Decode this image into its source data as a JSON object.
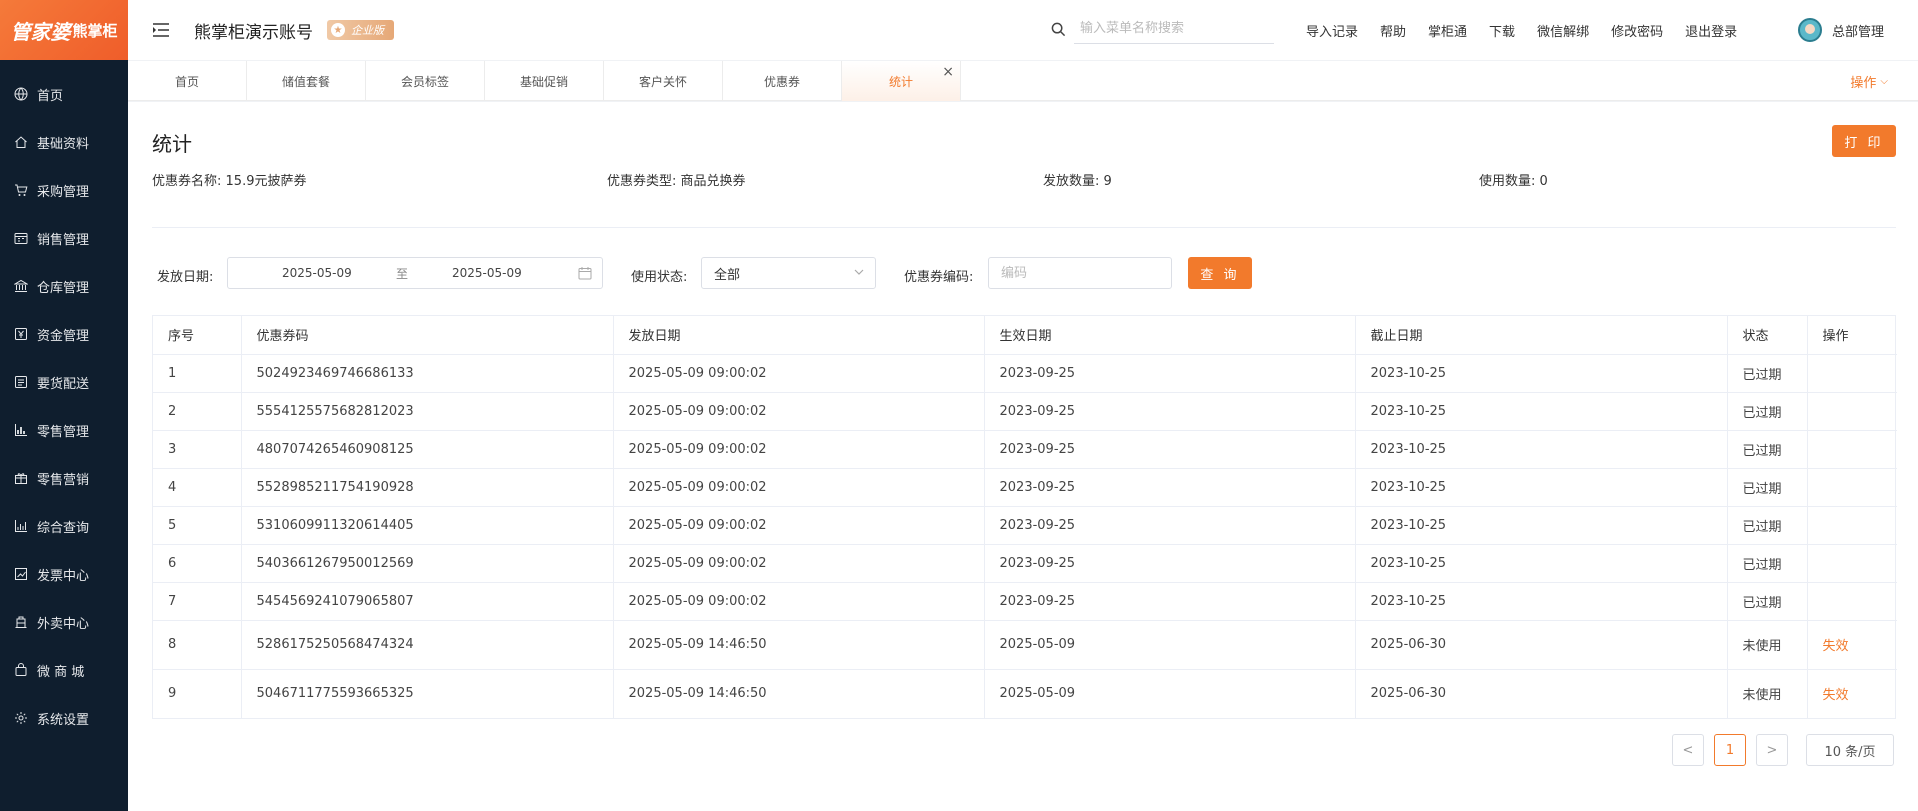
{
  "logo": {
    "text_a": "管家婆",
    "text_b": "熊掌柜"
  },
  "sidebar": {
    "items": [
      {
        "label": "首页",
        "icon": "globe-icon"
      },
      {
        "label": "基础资料",
        "icon": "home-icon"
      },
      {
        "label": "采购管理",
        "icon": "cart-icon"
      },
      {
        "label": "销售管理",
        "icon": "calendar-icon"
      },
      {
        "label": "仓库管理",
        "icon": "bank-icon"
      },
      {
        "label": "资金管理",
        "icon": "yen-icon"
      },
      {
        "label": "要货配送",
        "icon": "list-icon"
      },
      {
        "label": "零售管理",
        "icon": "bar-chart-icon"
      },
      {
        "label": "零售营销",
        "icon": "gift-icon"
      },
      {
        "label": "综合查询",
        "icon": "stats-icon"
      },
      {
        "label": "发票中心",
        "icon": "line-chart-icon"
      },
      {
        "label": "外卖中心",
        "icon": "delivery-icon"
      },
      {
        "label": "微 商 城",
        "icon": "bag-icon"
      },
      {
        "label": "系统设置",
        "icon": "gear-icon"
      }
    ]
  },
  "header": {
    "account_title": "熊掌柜演示账号",
    "badge": "企业版",
    "search_placeholder": "输入菜单名称搜索",
    "links": [
      "导入记录",
      "帮助",
      "掌柜通",
      "下载",
      "微信解绑",
      "修改密码",
      "退出登录"
    ],
    "user_name": "总部管理"
  },
  "tabs": {
    "items": [
      "首页",
      "储值套餐",
      "会员标签",
      "基础促销",
      "客户关怀",
      "优惠券",
      "统计"
    ],
    "active_index": 6,
    "ops_label": "操作"
  },
  "page": {
    "title": "统计",
    "print_label": "打 印",
    "info": [
      {
        "key": "优惠券名称:",
        "value": "15.9元披萨券"
      },
      {
        "key": "优惠券类型:",
        "value": "商品兑换券"
      },
      {
        "key": "发放数量:",
        "value": "9"
      },
      {
        "key": "使用数量:",
        "value": "0"
      }
    ]
  },
  "filters": {
    "date_label": "发放日期:",
    "date_start": "2025-05-09",
    "date_sep": "至",
    "date_end": "2025-05-09",
    "status_label": "使用状态:",
    "status_value": "全部",
    "code_label": "优惠券编码:",
    "code_placeholder": "编码",
    "query_label": "查 询"
  },
  "table": {
    "columns": [
      "序号",
      "优惠券码",
      "发放日期",
      "生效日期",
      "截止日期",
      "状态",
      "操作"
    ],
    "rows": [
      [
        "1",
        "5024923469746686133",
        "2025-05-09 09:00:02",
        "2023-09-25",
        "2023-10-25",
        "已过期",
        ""
      ],
      [
        "2",
        "5554125575682812023",
        "2025-05-09 09:00:02",
        "2023-09-25",
        "2023-10-25",
        "已过期",
        ""
      ],
      [
        "3",
        "4807074265460908125",
        "2025-05-09 09:00:02",
        "2023-09-25",
        "2023-10-25",
        "已过期",
        ""
      ],
      [
        "4",
        "5528985211754190928",
        "2025-05-09 09:00:02",
        "2023-09-25",
        "2023-10-25",
        "已过期",
        ""
      ],
      [
        "5",
        "5310609911320614405",
        "2025-05-09 09:00:02",
        "2023-09-25",
        "2023-10-25",
        "已过期",
        ""
      ],
      [
        "6",
        "5403661267950012569",
        "2025-05-09 09:00:02",
        "2023-09-25",
        "2023-10-25",
        "已过期",
        ""
      ],
      [
        "7",
        "5454569241079065807",
        "2025-05-09 09:00:02",
        "2023-09-25",
        "2023-10-25",
        "已过期",
        ""
      ],
      [
        "8",
        "5286175250568474324",
        "2025-05-09 14:46:50",
        "2025-05-09",
        "2025-06-30",
        "未使用",
        "失效"
      ],
      [
        "9",
        "5046711775593665325",
        "2025-05-09 14:46:50",
        "2025-05-09",
        "2025-06-30",
        "未使用",
        "失效"
      ]
    ]
  },
  "pagination": {
    "prev": "<",
    "current": "1",
    "next": ">",
    "page_size": "10 条/页"
  },
  "colors": {
    "accent": "#f27a2c",
    "sidebar_bg": "#0f1e2e"
  }
}
